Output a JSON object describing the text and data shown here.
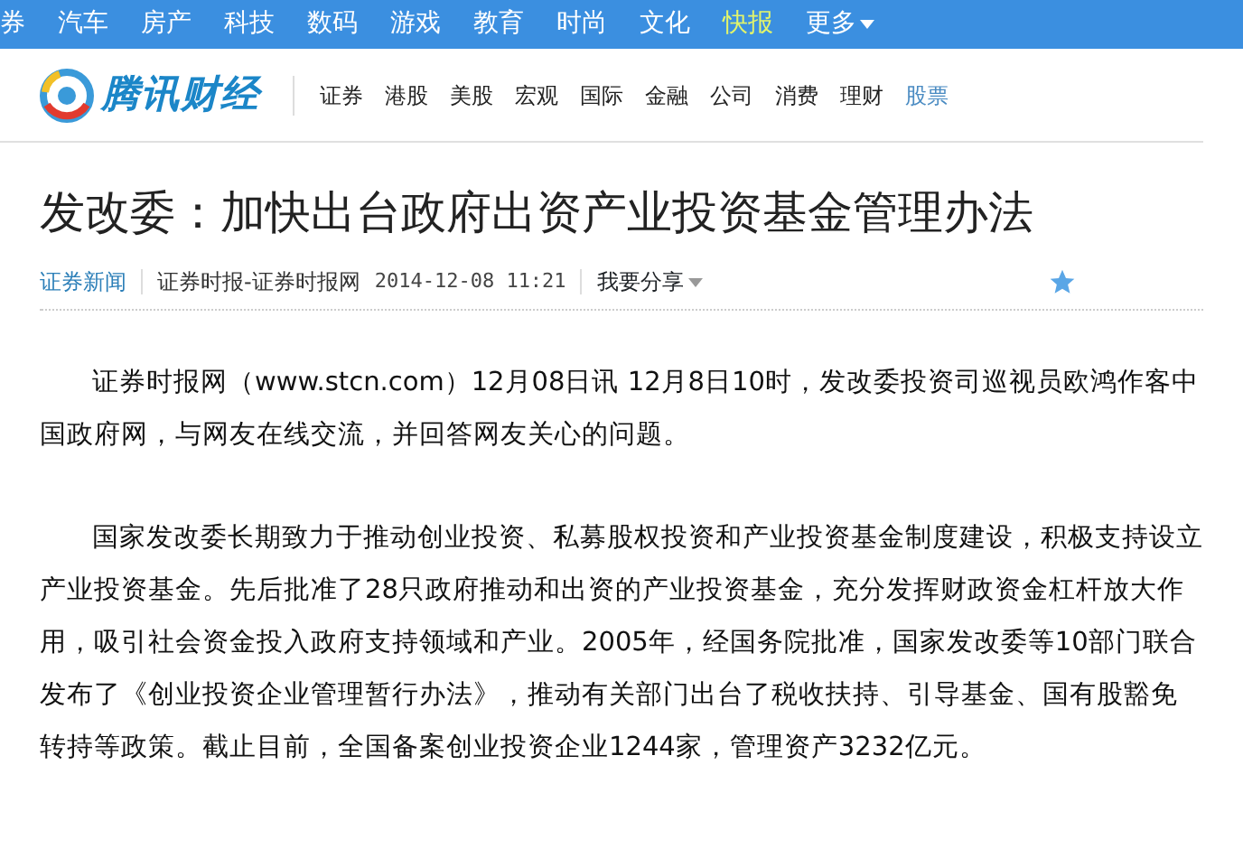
{
  "top_nav": {
    "items": [
      {
        "label": "券",
        "selected": false
      },
      {
        "label": "汽车",
        "selected": false
      },
      {
        "label": "房产",
        "selected": false
      },
      {
        "label": "科技",
        "selected": false
      },
      {
        "label": "数码",
        "selected": false
      },
      {
        "label": "游戏",
        "selected": false
      },
      {
        "label": "教育",
        "selected": false
      },
      {
        "label": "时尚",
        "selected": false
      },
      {
        "label": "文化",
        "selected": false
      },
      {
        "label": "快报",
        "selected": true
      }
    ],
    "more": "更多"
  },
  "header": {
    "logo_text": "腾讯财经",
    "channels": [
      {
        "label": "证券",
        "selected": false
      },
      {
        "label": "港股",
        "selected": false
      },
      {
        "label": "美股",
        "selected": false
      },
      {
        "label": "宏观",
        "selected": false
      },
      {
        "label": "国际",
        "selected": false
      },
      {
        "label": "金融",
        "selected": false
      },
      {
        "label": "公司",
        "selected": false
      },
      {
        "label": "消费",
        "selected": false
      },
      {
        "label": "理财",
        "selected": false
      },
      {
        "label": "股票",
        "selected": true
      }
    ]
  },
  "article": {
    "title": "发改委：加快出台政府出资产业投资基金管理办法",
    "meta": {
      "category": "证券新闻",
      "source": "证券时报-证券时报网",
      "time": "2014-12-08 11:21",
      "share": "我要分享"
    },
    "paragraphs": [
      "证券时报网（www.stcn.com）12月08日讯 12月8日10时，发改委投资司巡视员欧鸿作客中国政府网，与网友在线交流，并回答网友关心的问题。",
      "国家发改委长期致力于推动创业投资、私募股权投资和产业投资基金制度建设，积极支持设立产业投资基金。先后批准了28只政府推动和出资的产业投资基金，充分发挥财政资金杠杆放大作用，吸引社会资金投入政府支持领域和产业。2005年，经国务院批准，国家发改委等10部门联合发布了《创业投资企业管理暂行办法》，推动有关部门出台了税收扶持、引导基金、国有股豁免转持等政策。截止目前，全国备案创业投资企业1244家，管理资产3232亿元。"
    ]
  }
}
